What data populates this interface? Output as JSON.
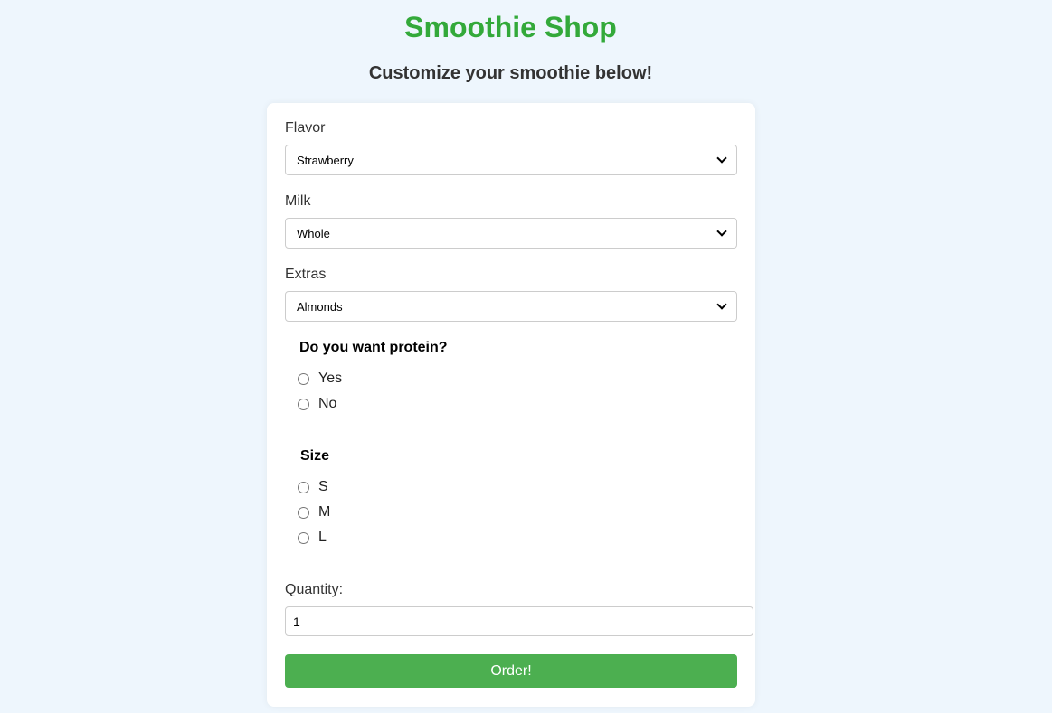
{
  "header": {
    "title": "Smoothie Shop",
    "subtitle": "Customize your smoothie below!"
  },
  "form": {
    "flavor": {
      "label": "Flavor",
      "value": "Strawberry"
    },
    "milk": {
      "label": "Milk",
      "value": "Whole"
    },
    "extras": {
      "label": "Extras",
      "value": "Almonds"
    },
    "protein": {
      "question": "Do you want protein?",
      "options": [
        "Yes",
        "No"
      ]
    },
    "size": {
      "question": "Size",
      "options": [
        "S",
        "M",
        "L"
      ]
    },
    "quantity": {
      "label": "Quantity:",
      "value": "1"
    },
    "order_label": "Order!"
  },
  "colors": {
    "accent": "#4caf50",
    "title": "#33a93a",
    "background": "#eef6fd"
  }
}
